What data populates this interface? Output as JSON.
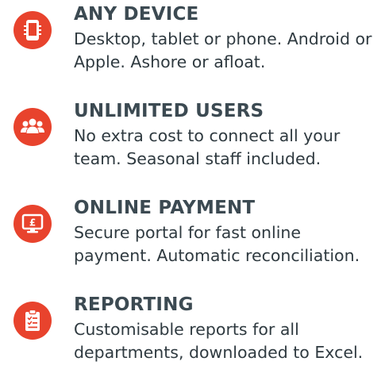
{
  "brand": {
    "accent": "#e8432d",
    "heading_color": "#3c4a52",
    "text_color": "#2f3a40"
  },
  "features": [
    {
      "icon": "device-icon",
      "title": "ANY DEVICE",
      "description": "Desktop, tablet or phone. Android or Apple. Ashore or afloat."
    },
    {
      "icon": "users-icon",
      "title": "UNLIMITED USERS",
      "description": "No extra cost to connect all your team. Seasonal staff included."
    },
    {
      "icon": "monitor-pound-icon",
      "title": "ONLINE PAYMENT",
      "description": "Secure portal for fast online payment. Automatic reconciliation."
    },
    {
      "icon": "clipboard-checklist-icon",
      "title": "REPORTING",
      "description": "Customisable reports for all departments, downloaded to Excel."
    }
  ]
}
